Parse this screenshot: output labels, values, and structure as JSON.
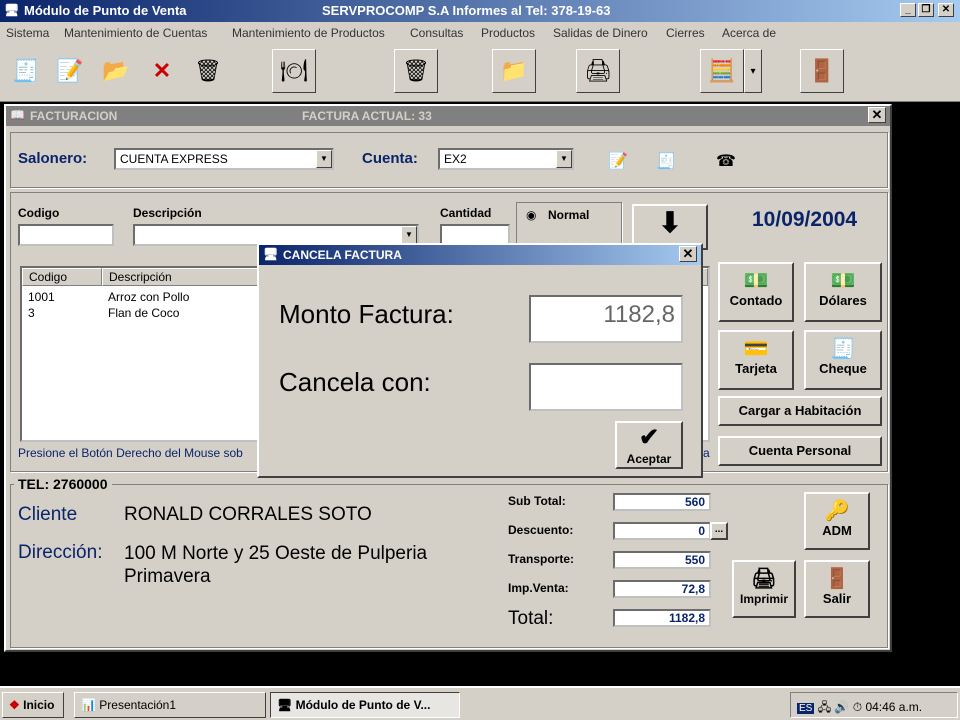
{
  "app": {
    "title": "Módulo de Punto de Venta",
    "subtitle": "SERVPROCOMP S.A  Informes al Tel:  378-19-63",
    "minimize": "_",
    "maximize": "❐",
    "close": "✕"
  },
  "menu": [
    "Sistema",
    "Mantenimiento de Cuentas",
    "Mantenimiento de Productos",
    "Consultas",
    "Productos",
    "Salidas de Dinero",
    "Cierres",
    "Acerca de"
  ],
  "toolbar": {
    "icons": [
      "cash-register-icon",
      "notepad-edit-icon",
      "open-file-icon",
      "delete-x-icon",
      "basket-icon",
      "products-icon",
      "trash-icon",
      "folder-icon",
      "printer-icon",
      "calculator-icon",
      "exit-door-icon"
    ],
    "dropdown_arrow": "▾"
  },
  "facturacion": {
    "title": "FACTURACION",
    "current_invoice_label": "FACTURA ACTUAL:  33",
    "salonero_label": "Salonero:",
    "salonero_value": "CUENTA EXPRESS",
    "cuenta_label": "Cuenta:",
    "cuenta_value": "EX2",
    "codigo_label": "Codigo",
    "descripcion_label": "Descripción",
    "cantidad_label": "Cantidad",
    "radio_normal": "Normal",
    "date": "10/09/2004",
    "list_headers": [
      "Codigo",
      "Descripción"
    ],
    "items": [
      {
        "codigo": "1001",
        "descripcion": "Arroz con Pollo"
      },
      {
        "codigo": "3",
        "descripcion": "Flan de Coco"
      }
    ],
    "hint": "Presione el Botón Derecho del Mouse sob",
    "hint_tail": "a",
    "payment_buttons": {
      "contado": "Contado",
      "dolares": "Dólares",
      "tarjeta": "Tarjeta",
      "cheque": "Cheque",
      "habitacion": "Cargar a Habitación",
      "personal": "Cuenta Personal"
    }
  },
  "customer": {
    "tel": "TEL:  2760000",
    "cliente_label": "Cliente",
    "cliente_value": "RONALD CORRALES SOTO",
    "direccion_label": "Dirección:",
    "direccion_line1": "100 M Norte y 25 Oeste de Pulperia",
    "direccion_line2": "Primavera"
  },
  "totals": {
    "subtotal_label": "Sub Total:",
    "subtotal": "560",
    "descuento_label": "Descuento:",
    "descuento": "0",
    "descuento_btn": "...",
    "transporte_label": "Transporte:",
    "transporte": "550",
    "impventa_label": "Imp.Venta:",
    "impventa": "72,8",
    "total_label": "Total:",
    "total": "1182,8"
  },
  "actions": {
    "adm": "ADM",
    "imprimir": "Imprimir",
    "salir": "Salir"
  },
  "dialog": {
    "title": "CANCELA FACTURA",
    "monto_label": "Monto Factura:",
    "monto_value": "1182,8",
    "cancela_label": "Cancela con:",
    "cancela_value": "",
    "accept": "Aceptar"
  },
  "taskbar": {
    "start": "Inicio",
    "task1": "Presentación1",
    "task2": "Módulo de Punto de V...",
    "lang": "ES",
    "clock": "04:46 a.m."
  }
}
